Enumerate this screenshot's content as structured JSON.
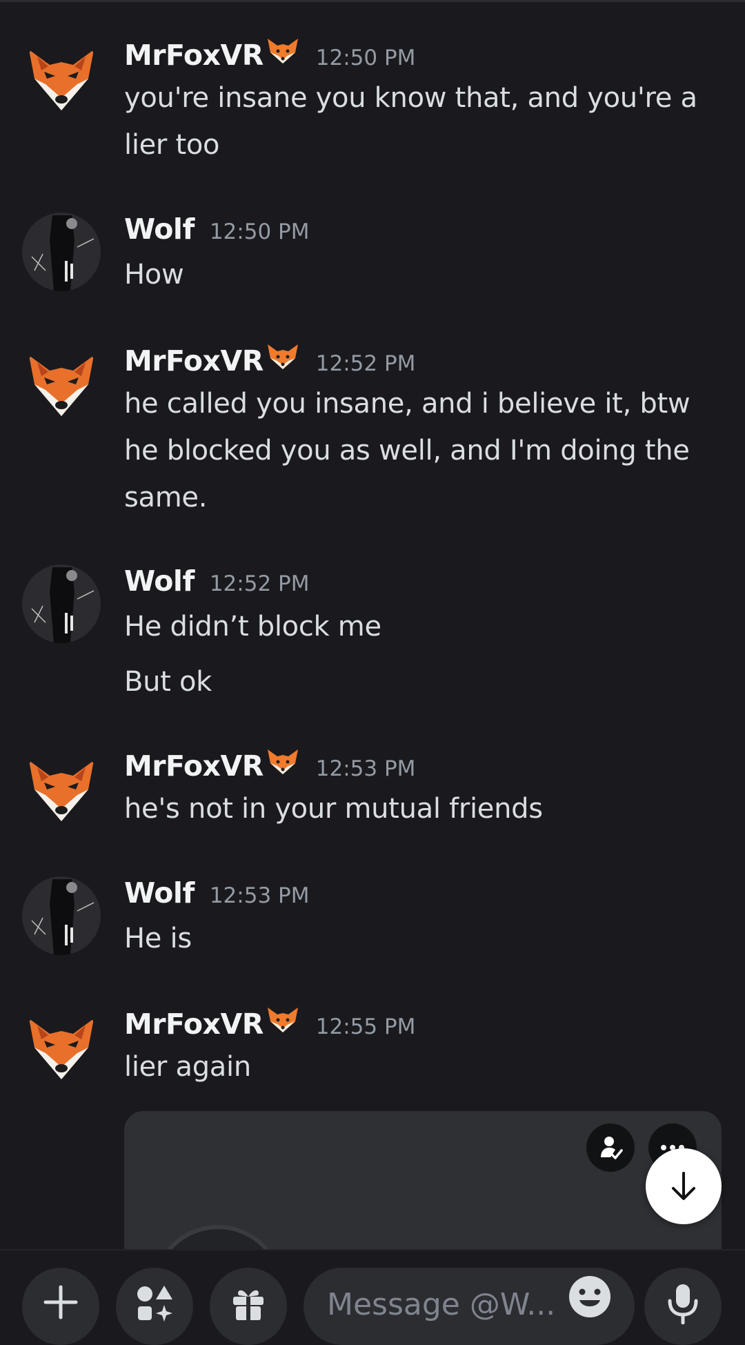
{
  "colors": {
    "background": "#1a1a1e",
    "username": "#f2f3f5",
    "message_text": "#dbdee1",
    "timestamp": "#949ba4",
    "input_bg": "#2b2d31"
  },
  "messages": [
    {
      "author": "MrFoxVR",
      "emoji": "fox-emoji",
      "avatar": "fox-avatar",
      "time": "12:50 PM",
      "lines": [
        "you're insane you know that, and you're a lier too"
      ]
    },
    {
      "author": "Wolf",
      "avatar": "wolf-avatar",
      "time": "12:50 PM",
      "lines": [
        "How"
      ]
    },
    {
      "author": "MrFoxVR",
      "emoji": "fox-emoji",
      "avatar": "fox-avatar",
      "time": "12:52 PM",
      "lines": [
        "he called you insane, and i believe it, btw he blocked you as well, and I'm doing the same."
      ]
    },
    {
      "author": "Wolf",
      "avatar": "wolf-avatar",
      "time": "12:52 PM",
      "lines": [
        "He didn’t block me",
        "But ok"
      ]
    },
    {
      "author": "MrFoxVR",
      "emoji": "fox-emoji",
      "avatar": "fox-avatar",
      "time": "12:53 PM",
      "lines": [
        "he's not in your mutual friends"
      ]
    },
    {
      "author": "Wolf",
      "avatar": "wolf-avatar",
      "time": "12:53 PM",
      "lines": [
        "He is"
      ]
    },
    {
      "author": "MrFoxVR",
      "emoji": "fox-emoji",
      "avatar": "fox-avatar",
      "time": "12:55 PM",
      "lines": [
        "lier again"
      ]
    }
  ],
  "embed_card": {
    "buttons": [
      "profile-check-icon",
      "more-options-icon"
    ]
  },
  "composer": {
    "placeholder": "Message @W...",
    "buttons": [
      "plus-icon",
      "apps-icon",
      "gift-icon",
      "emoji-icon",
      "microphone-icon"
    ]
  },
  "jump_button": "arrow-down-icon"
}
